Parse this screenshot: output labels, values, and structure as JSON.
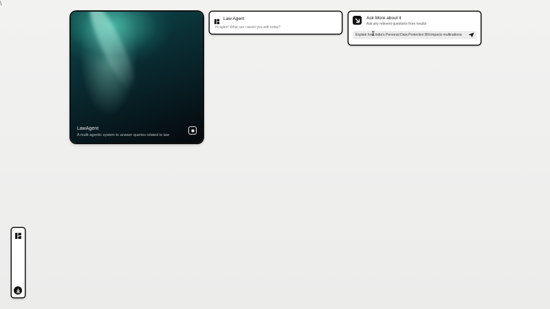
{
  "corner_mark": "\\",
  "hero": {
    "title": "LawAgent",
    "subtitle": "A multi-agentic system to answer queries related to law",
    "icon": "square-stop-icon"
  },
  "agent": {
    "title": "Law Agent",
    "message": "Hi again! What can i assist you with today?",
    "icon": "law-agent-logo-icon"
  },
  "ask": {
    "title": "Ask More about it",
    "subtitle": "Ask any relevent questions from results",
    "input_value": "Explain how India's Personal Data Protection Bill impacts multinationa",
    "icon": "arrow-down-right-icon",
    "send_icon": "send-icon"
  },
  "dock": {
    "logo_icon": "law-agent-logo-icon",
    "download_icon": "download-icon"
  },
  "colors": {
    "background": "#efefee",
    "card": "#ffffff",
    "dark": "#111111"
  }
}
